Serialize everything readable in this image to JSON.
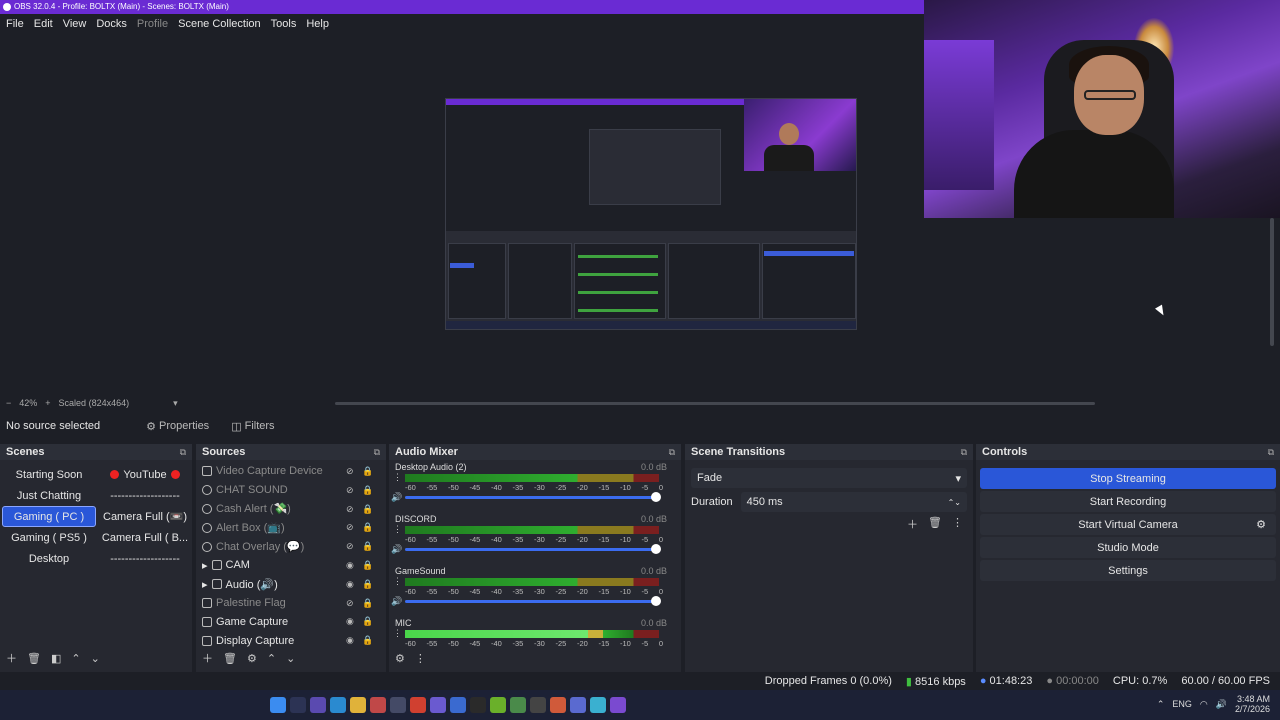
{
  "window": {
    "title": "OBS 32.0.4 - Profile: BOLTX (Main) - Scenes: BOLTX (Main)"
  },
  "menu": [
    "File",
    "Edit",
    "View",
    "Docks",
    "Profile",
    "Scene Collection",
    "Tools",
    "Help"
  ],
  "zoom": {
    "minus": "−",
    "value": "42%",
    "plus": "+",
    "scaled": "Scaled (824x464)",
    "caret": "▾"
  },
  "source_bar": {
    "no_source": "No source selected",
    "properties": "Properties",
    "filters": "Filters"
  },
  "scenes": {
    "title": "Scenes",
    "items": [
      "Starting Soon",
      "YouTube",
      "Just Chatting",
      "-------------------",
      "Gaming ( PC )",
      "Camera Full (📼)",
      "Gaming ( PS5 )",
      "Camera Full ( B...",
      "Desktop",
      "-------------------"
    ]
  },
  "sources": {
    "title": "Sources",
    "items": [
      "Video Capture Device",
      "CHAT SOUND",
      "Cash Alert (💸)",
      "Alert Box (📺)",
      "Chat Overlay (💬)",
      "CAM",
      "Audio (🔊)",
      "Palestine Flag",
      "Game Capture",
      "Display Capture"
    ]
  },
  "mixer": {
    "title": "Audio Mixer",
    "channels": [
      {
        "name": "Desktop Audio (2)",
        "db": "0.0 dB"
      },
      {
        "name": "DISCORD",
        "db": "0.0 dB"
      },
      {
        "name": "GameSound",
        "db": "0.0 dB"
      },
      {
        "name": "MIC",
        "db": "0.0 dB"
      }
    ],
    "scale": [
      "-60",
      "-55",
      "-50",
      "-45",
      "-40",
      "-35",
      "-30",
      "-25",
      "-20",
      "-15",
      "-10",
      "-5",
      "0"
    ]
  },
  "transitions": {
    "title": "Scene Transitions",
    "selected": "Fade",
    "duration_label": "Duration",
    "duration_value": "450 ms"
  },
  "controls": {
    "title": "Controls",
    "stop_streaming": "Stop Streaming",
    "start_recording": "Start Recording",
    "start_virtual_camera": "Start Virtual Camera",
    "studio_mode": "Studio Mode",
    "settings": "Settings"
  },
  "status": {
    "dropped": "Dropped Frames 0 (0.0%)",
    "bitrate": "8516 kbps",
    "stream_time": "01:48:23",
    "rec_time": "00:00:00",
    "cpu": "CPU: 0.7%",
    "fps": "60.00 / 60.00 FPS"
  },
  "tray": {
    "lang": "ENG",
    "time": "3:48 AM",
    "date": "2/7/2026"
  },
  "colors": {
    "accent": "#2a57d8",
    "title": "#6a2bd3",
    "panel": "#262830",
    "bg": "#1d1f26"
  }
}
